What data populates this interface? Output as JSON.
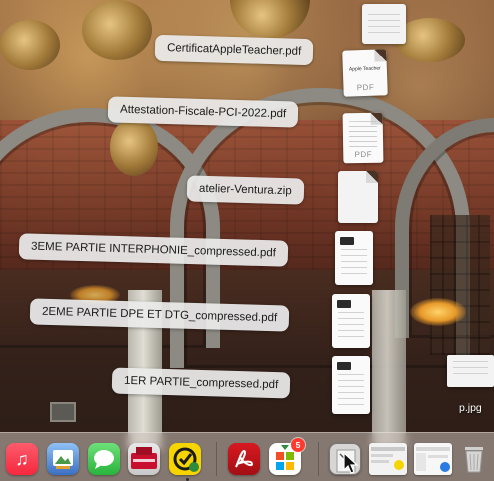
{
  "stack": {
    "files": [
      {
        "name": "CertificatAppleTeacher.pdf",
        "ext": "PDF"
      },
      {
        "name": "Attestation-Fiscale-PCI-2022.pdf",
        "ext": "PDF"
      },
      {
        "name": "atelier-Ventura.zip",
        "ext": ""
      },
      {
        "name": "3EME PARTIE INTERPHONIE_compressed.pdf",
        "ext": ""
      },
      {
        "name": "2EME PARTIE DPE ET DTG_compressed.pdf",
        "ext": ""
      },
      {
        "name": "1ER PARTIE_compressed.pdf",
        "ext": ""
      }
    ],
    "top_thumb_title": "Apple Teacher"
  },
  "desktop": {
    "jpg_file_label": "p.jpg"
  },
  "dock": {
    "apps": [
      {
        "name": "Music",
        "icon": "music-note-icon",
        "color": "#fa3a4f"
      },
      {
        "name": "Preview",
        "icon": "preview-icon",
        "color": "#5b8fd6"
      },
      {
        "name": "Messages",
        "icon": "speech-bubble-icon",
        "color": "#34c759"
      },
      {
        "name": "Pronote",
        "icon": "pronote-icon",
        "color": "#c8102e"
      },
      {
        "name": "Task app",
        "icon": "checkmark-icon",
        "color": "#f5d400"
      },
      {
        "name": "Acrobat Reader",
        "icon": "acrobat-icon",
        "color": "#c4121a"
      },
      {
        "name": "Microsoft Office",
        "icon": "office-icon",
        "color": "#ffffff"
      }
    ],
    "office_badge": "5",
    "items": [
      {
        "name": "Downloads stack",
        "icon": "stack-icon"
      },
      {
        "name": "Screenshot thumbnail",
        "icon": "screenshot-icon"
      },
      {
        "name": "Finder window thumbnail",
        "icon": "window-icon"
      },
      {
        "name": "Trash",
        "icon": "trash-icon"
      }
    ]
  }
}
